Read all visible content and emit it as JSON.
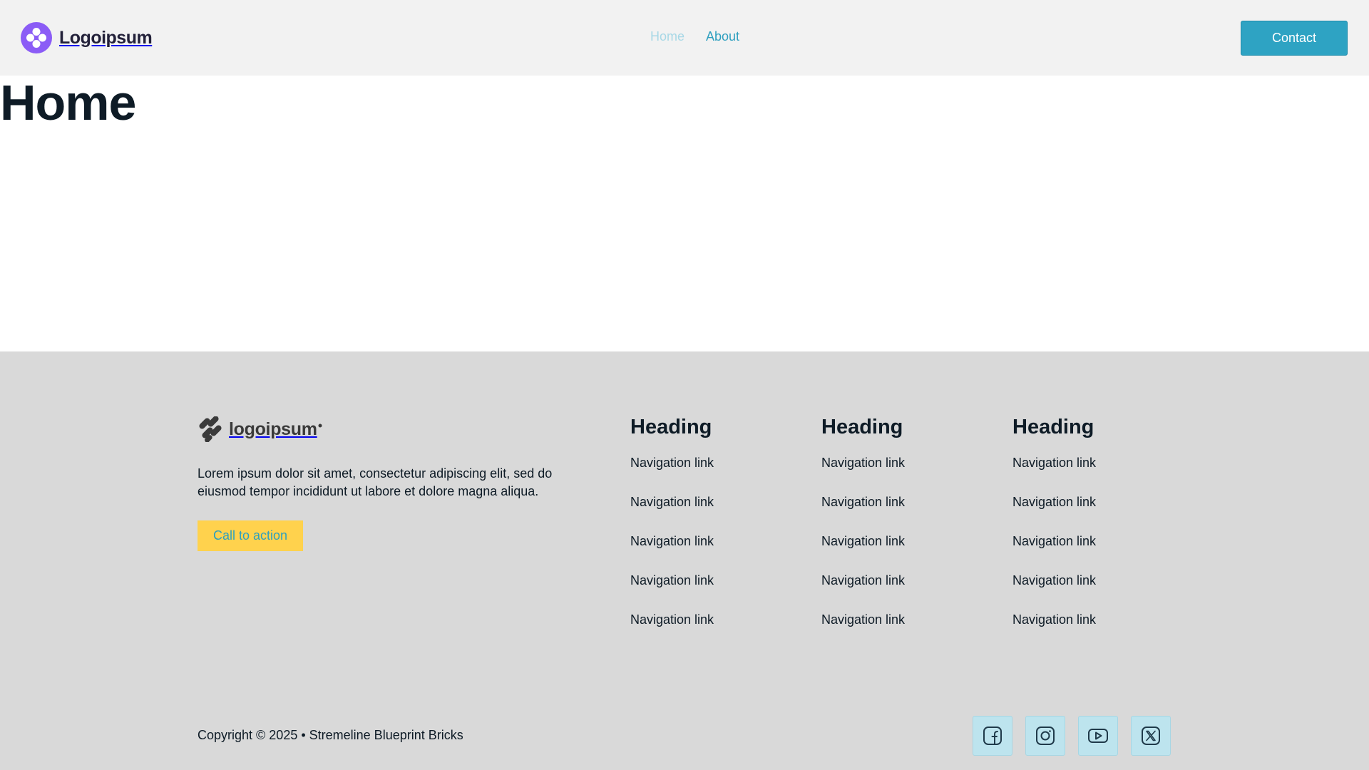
{
  "colors": {
    "header_bg": "#f2f2f2",
    "footer_bg": "#d9d9d9",
    "accent": "#2ea3c3",
    "cta_bg": "#ffd24d",
    "brand_purple": "#8b5cf6",
    "text_dark": "#0e1b26"
  },
  "header": {
    "brand_name": "Logoipsum",
    "brand_icon": "flower-logo-icon",
    "nav": [
      {
        "label": "Home",
        "active": true
      },
      {
        "label": "About",
        "active": false
      }
    ],
    "contact_label": "Contact"
  },
  "main": {
    "title": "Home"
  },
  "footer": {
    "logo_text": "logoipsum",
    "logo_icon": "pill-cluster-logo-icon",
    "description": "Lorem ipsum dolor sit amet, consectetur adipiscing elit, sed do eiusmod tempor incididunt ut labore et dolore magna aliqua.",
    "cta_label": "Call to action",
    "columns": [
      {
        "heading": "Heading",
        "links": [
          "Navigation link",
          "Navigation link",
          "Navigation link",
          "Navigation link",
          "Navigation link"
        ]
      },
      {
        "heading": "Heading",
        "links": [
          "Navigation link",
          "Navigation link",
          "Navigation link",
          "Navigation link",
          "Navigation link"
        ]
      },
      {
        "heading": "Heading",
        "links": [
          "Navigation link",
          "Navigation link",
          "Navigation link",
          "Navigation link",
          "Navigation link"
        ]
      }
    ],
    "copyright": "Copyright © 2025 • Stremeline Blueprint Bricks",
    "socials": [
      {
        "name": "facebook-icon"
      },
      {
        "name": "instagram-icon"
      },
      {
        "name": "youtube-icon"
      },
      {
        "name": "x-twitter-icon"
      }
    ]
  }
}
